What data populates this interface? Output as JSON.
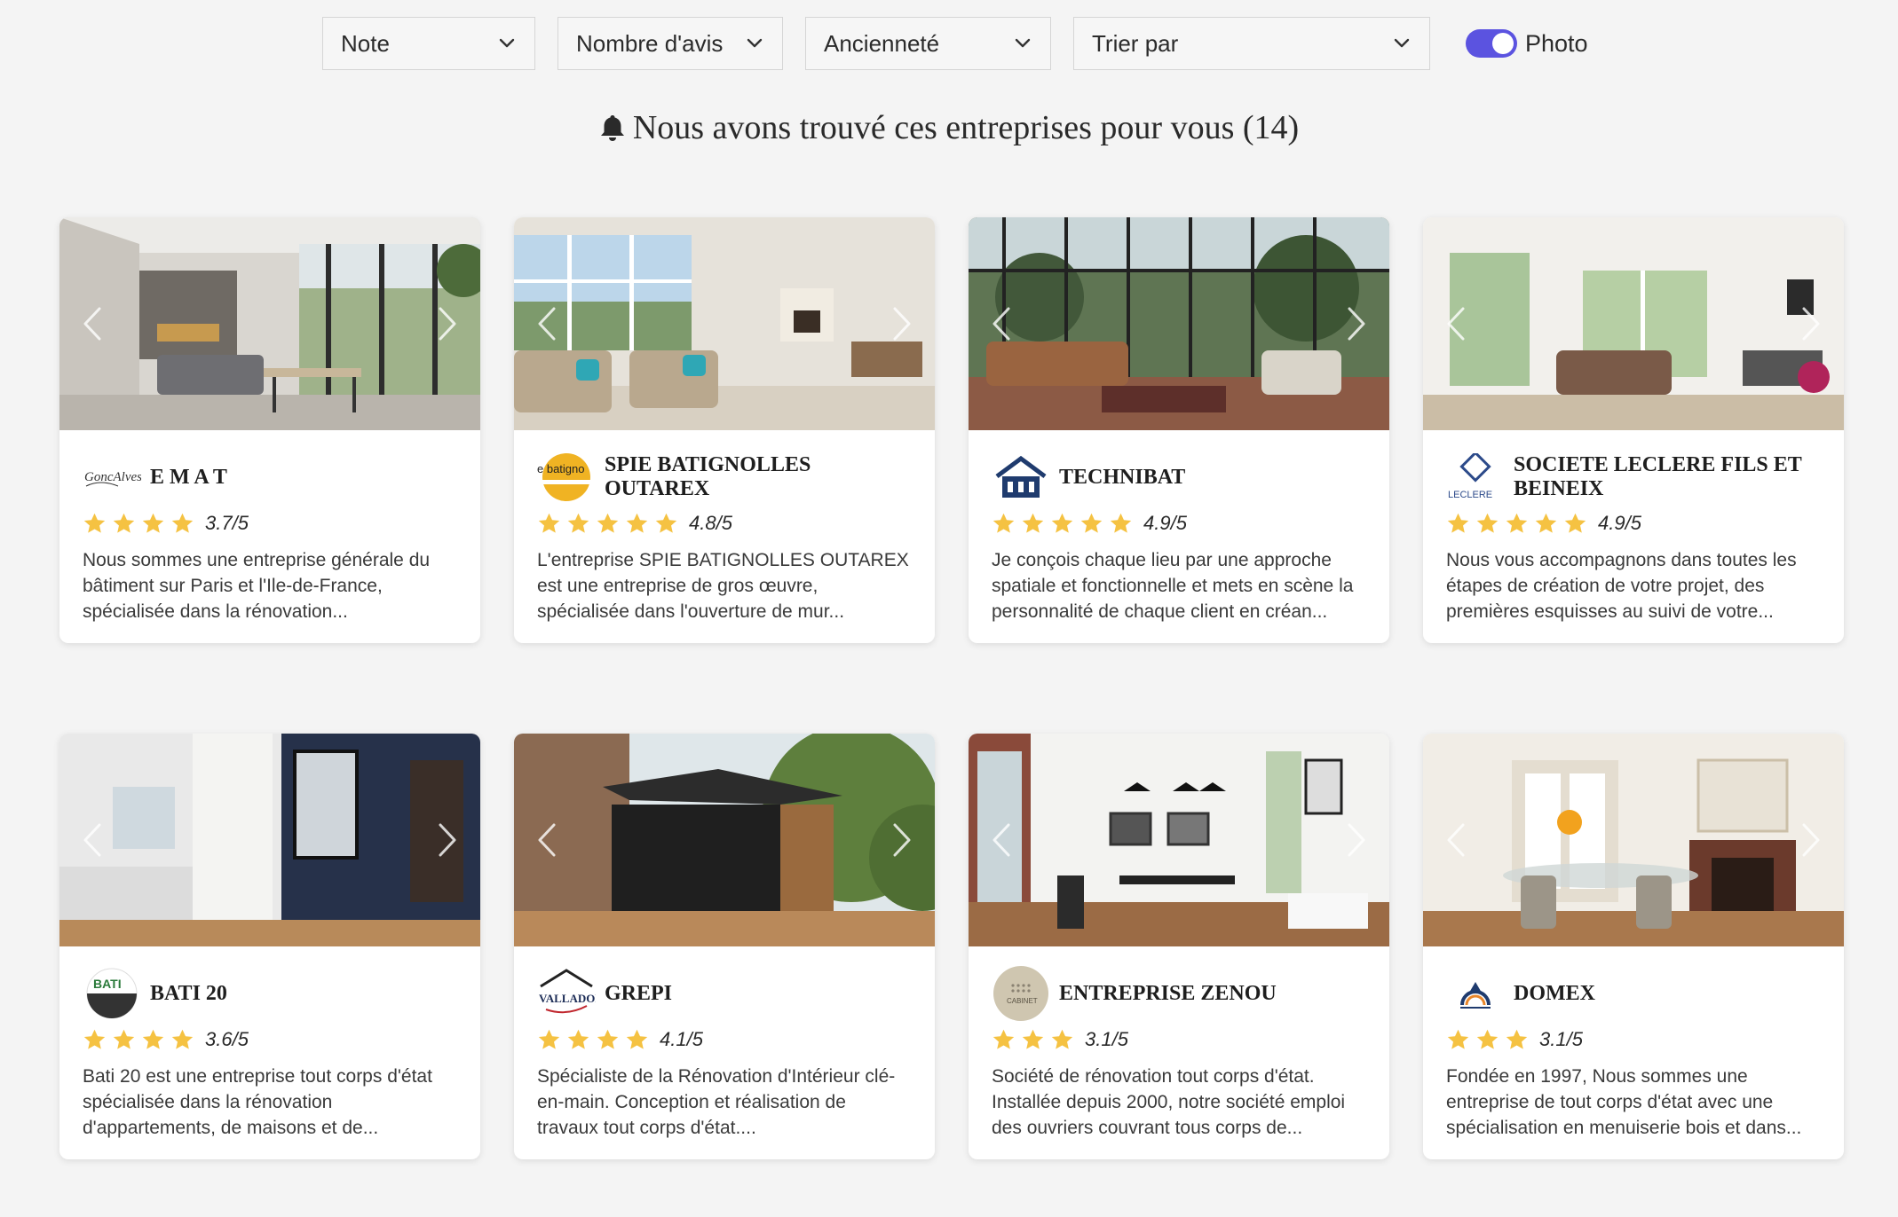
{
  "filters": {
    "note": "Note",
    "nombre_avis": "Nombre d'avis",
    "anciennete": "Ancienneté",
    "trier_par": "Trier par",
    "photo_label": "Photo",
    "photo_enabled": true
  },
  "heading": "Nous avons trouvé ces entreprises pour vous (14)",
  "colors": {
    "accent": "#5b53e0",
    "star": "#f5c242",
    "background": "#f4f4f4"
  },
  "icons": {
    "dropdown": "chevron-down-icon",
    "bell": "bell-icon",
    "arrows": [
      "chevron-left-icon",
      "chevron-right-icon"
    ],
    "rating": "star-icon"
  },
  "companies": [
    {
      "name": "E M A T",
      "score": "3.7/5",
      "stars": 4,
      "logo_text": "GoncAlves",
      "description": "Nous sommes une entreprise générale du bâtiment sur Paris et l'Ile-de-France, spécialisée dans la rénovation..."
    },
    {
      "name": "SPIE BATIGNOLLES OUTAREX",
      "score": "4.8/5",
      "stars": 5,
      "logo_text": "e batigno",
      "description": "L'entreprise SPIE BATIGNOLLES OUTAREX est une entreprise de gros œuvre, spécialisée dans l'ouverture de mur..."
    },
    {
      "name": "TECHNIBAT",
      "score": "4.9/5",
      "stars": 5,
      "logo_text": "",
      "description": "Je conçois chaque lieu par une approche spatiale et fonctionnelle et mets en scène la personnalité de chaque client en créan..."
    },
    {
      "name": "SOCIETE LECLERE FILS ET BEINEIX",
      "score": "4.9/5",
      "stars": 5,
      "logo_text": "LECLERE",
      "description": "Nous vous accompagnons dans toutes les étapes de création de votre projet, des premières esquisses au suivi de votre..."
    },
    {
      "name": "BATI 20",
      "score": "3.6/5",
      "stars": 4,
      "logo_text": "BATI",
      "description": "Bati 20 est une entreprise tout corps d'état spécialisée dans la rénovation d'appartements, de maisons et de..."
    },
    {
      "name": "GREPI",
      "score": "4.1/5",
      "stars": 4,
      "logo_text": "VALLADON",
      "description": "Spécialiste de la Rénovation d'Intérieur clé-en-main. Conception et réalisation de travaux tout corps d'état...."
    },
    {
      "name": "ENTREPRISE ZENOU",
      "score": "3.1/5",
      "stars": 3,
      "logo_text": "CABINET",
      "description": "Société de rénovation tout corps d'état. Installée depuis 2000, notre société emploi des ouvriers couvrant tous corps de..."
    },
    {
      "name": "DOMEX",
      "score": "3.1/5",
      "stars": 3,
      "logo_text": "",
      "description": "Fondée en 1997, Nous sommes une entreprise de tout corps d'état avec une spécialisation en menuiserie bois et dans..."
    }
  ]
}
